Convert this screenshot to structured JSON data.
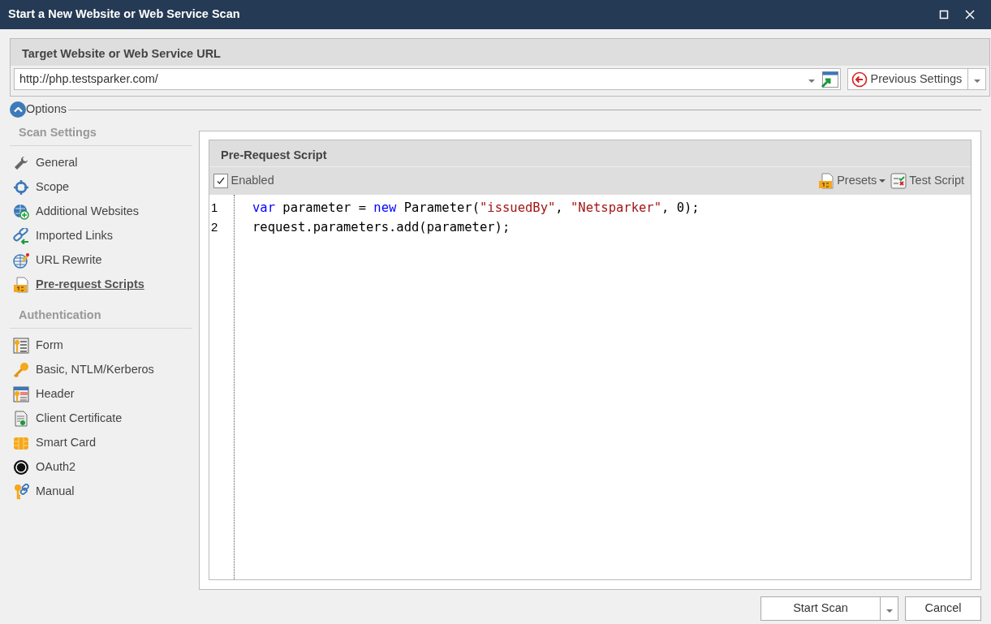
{
  "window": {
    "title": "Start a New Website or Web Service Scan"
  },
  "target": {
    "heading": "Target Website or Web Service URL",
    "url": {
      "value": "http://php.testsparker.com/"
    },
    "previous_settings": {
      "label": "Previous Settings"
    }
  },
  "options": {
    "label": "Options",
    "expanded": true
  },
  "sidebar": {
    "sections": [
      {
        "heading": "Scan Settings",
        "items": [
          {
            "label": "General",
            "selected": false
          },
          {
            "label": "Scope",
            "selected": false
          },
          {
            "label": "Additional Websites",
            "selected": false
          },
          {
            "label": "Imported Links",
            "selected": false
          },
          {
            "label": "URL Rewrite",
            "selected": false
          },
          {
            "label": "Pre-request Scripts",
            "selected": true
          }
        ]
      },
      {
        "heading": "Authentication",
        "items": [
          {
            "label": "Form",
            "selected": false
          },
          {
            "label": "Basic, NTLM/Kerberos",
            "selected": false
          },
          {
            "label": "Header",
            "selected": false
          },
          {
            "label": "Client Certificate",
            "selected": false
          },
          {
            "label": "Smart Card",
            "selected": false
          },
          {
            "label": "OAuth2",
            "selected": false
          },
          {
            "label": "Manual",
            "selected": false
          }
        ]
      }
    ]
  },
  "panel": {
    "title": "Pre-Request Script",
    "enabled": {
      "label": "Enabled",
      "checked": true
    },
    "toolbar": [
      {
        "label": "Presets",
        "kind": "dropdown"
      },
      {
        "label": "Test Script",
        "kind": "button"
      }
    ],
    "code": {
      "lines": [
        {
          "number": "1",
          "tokens": [
            {
              "text": "var",
              "kind": "keyword"
            },
            {
              "text": " parameter = ",
              "kind": "plain"
            },
            {
              "text": "new",
              "kind": "keyword"
            },
            {
              "text": " Parameter(",
              "kind": "plain"
            },
            {
              "text": "\"issuedBy\"",
              "kind": "string"
            },
            {
              "text": ", ",
              "kind": "plain"
            },
            {
              "text": "\"Netsparker\"",
              "kind": "string"
            },
            {
              "text": ", 0);",
              "kind": "plain"
            }
          ]
        },
        {
          "number": "2",
          "tokens": [
            {
              "text": "request.parameters.add(parameter);",
              "kind": "plain"
            }
          ]
        }
      ]
    }
  },
  "footer": {
    "buttons": [
      {
        "label": "Start Scan",
        "kind": "split"
      },
      {
        "label": "Cancel",
        "kind": "plain"
      }
    ]
  }
}
